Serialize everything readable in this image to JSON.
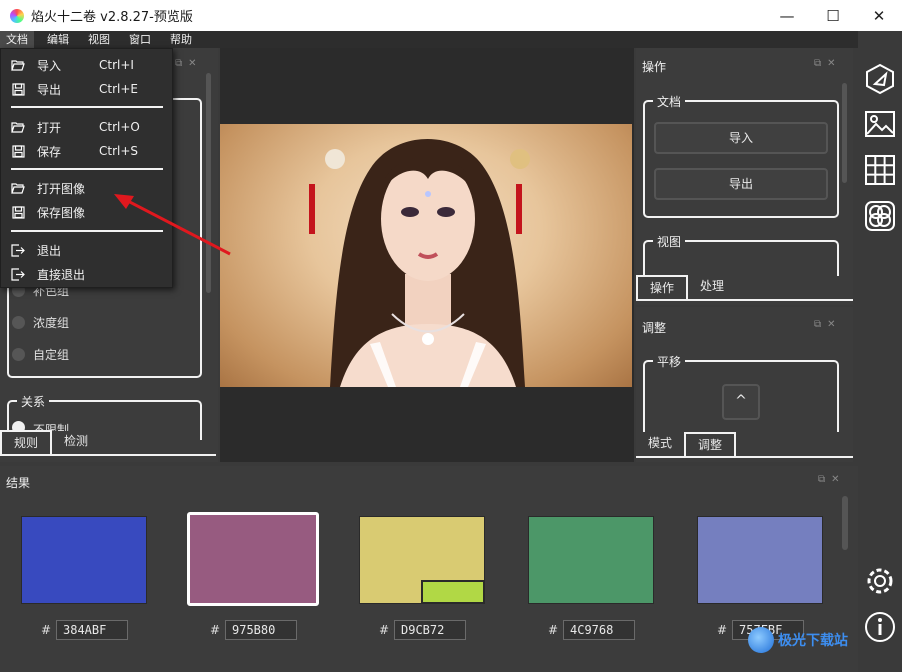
{
  "window": {
    "title": "焰火十二卷 v2.8.27-预览版",
    "minimize": "—",
    "maximize": "☐",
    "close": "✕"
  },
  "menubar": [
    "文档",
    "编辑",
    "视图",
    "窗口",
    "帮助"
  ],
  "file_menu": {
    "items": [
      {
        "label": "导入",
        "shortcut": "Ctrl+I",
        "icon": "folder-open-icon"
      },
      {
        "label": "导出",
        "shortcut": "Ctrl+E",
        "icon": "save-icon"
      },
      {
        "label": "打开",
        "shortcut": "Ctrl+O",
        "icon": "folder-open-icon"
      },
      {
        "label": "保存",
        "shortcut": "Ctrl+S",
        "icon": "save-icon"
      },
      {
        "label": "打开图像",
        "shortcut": "",
        "icon": "folder-open-icon"
      },
      {
        "label": "保存图像",
        "shortcut": "",
        "icon": "save-icon"
      },
      {
        "label": "退出",
        "shortcut": "",
        "icon": "exit-icon"
      },
      {
        "label": "直接退出",
        "shortcut": "",
        "icon": "exit-icon"
      }
    ]
  },
  "left_panel": {
    "color_group_options": [
      "补色组",
      "浓度组",
      "自定组"
    ],
    "relation_title": "关系",
    "relation_option": "不限制",
    "tabs": [
      "规则",
      "检测"
    ]
  },
  "operations_panel": {
    "title": "操作",
    "doc_group_title": "文档",
    "import_button": "导入",
    "export_button": "导出",
    "view_group_title": "视图",
    "tabs": [
      "操作",
      "处理"
    ]
  },
  "adjust_panel": {
    "title": "调整",
    "pan_group_title": "平移",
    "up_arrow": "^",
    "tabs": [
      "模式",
      "调整"
    ]
  },
  "results": {
    "title": "结果",
    "swatches": [
      {
        "color": "#384ABF",
        "hex": "384ABF",
        "selected": false
      },
      {
        "color": "#975B80",
        "hex": "975B80",
        "selected": true
      },
      {
        "color": "#D9CB72",
        "hex": "D9CB72",
        "selected": false
      },
      {
        "color": "#4C9768",
        "hex": "4C9768",
        "selected": false
      },
      {
        "color": "#757FBF",
        "hex": "757FBF",
        "selected": false
      }
    ]
  },
  "right_toolbar": [
    "triangle-icon",
    "image-icon",
    "grid-icon",
    "circles-icon",
    "settings-icon",
    "info-icon"
  ],
  "watermark": "极光下载站"
}
